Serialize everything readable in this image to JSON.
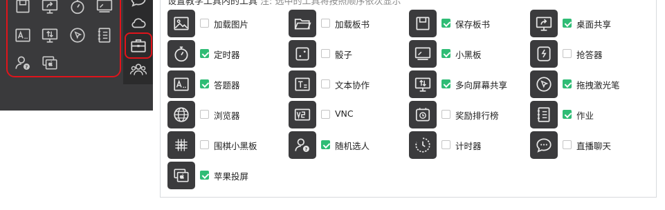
{
  "settings": {
    "title": "设置教学工具内的工具",
    "note": "注: 选中的工具将按照顺序依次显示"
  },
  "tools": [
    {
      "label": "加载图片",
      "checked": false,
      "icon": "image-icon"
    },
    {
      "label": "加载板书",
      "checked": false,
      "icon": "folder-icon"
    },
    {
      "label": "保存板书",
      "checked": true,
      "icon": "save-icon"
    },
    {
      "label": "桌面共享",
      "checked": true,
      "icon": "screen-share-icon"
    },
    {
      "label": "定时器",
      "checked": true,
      "icon": "stopwatch-icon"
    },
    {
      "label": "骰子",
      "checked": false,
      "icon": "dice-icon"
    },
    {
      "label": "小黑板",
      "checked": true,
      "icon": "blackboard-icon"
    },
    {
      "label": "抢答器",
      "checked": false,
      "icon": "buzzer-icon"
    },
    {
      "label": "答题器",
      "checked": true,
      "icon": "answer-icon"
    },
    {
      "label": "文本协作",
      "checked": false,
      "icon": "text-collab-icon"
    },
    {
      "label": "多向屏幕共享",
      "checked": true,
      "icon": "multi-screen-icon"
    },
    {
      "label": "拖拽激光笔",
      "checked": true,
      "icon": "laser-pointer-icon"
    },
    {
      "label": "浏览器",
      "checked": false,
      "icon": "globe-icon"
    },
    {
      "label": "VNC",
      "checked": false,
      "icon": "vnc-icon"
    },
    {
      "label": "奖励排行榜",
      "checked": false,
      "icon": "reward-icon"
    },
    {
      "label": "作业",
      "checked": true,
      "icon": "homework-icon"
    },
    {
      "label": "围棋小黑板",
      "checked": false,
      "icon": "go-board-icon"
    },
    {
      "label": "随机选人",
      "checked": true,
      "icon": "random-person-icon"
    },
    {
      "label": "计时器",
      "checked": false,
      "icon": "timer-icon"
    },
    {
      "label": "直播聊天",
      "checked": false,
      "icon": "chat-icon"
    },
    {
      "label": "苹果投屏",
      "checked": true,
      "icon": "apple-cast-icon"
    }
  ],
  "preview": {
    "toolbox_icons": [
      "save-icon",
      "screen-share-icon",
      "stopwatch-icon",
      "blackboard-icon",
      "answer-icon",
      "multi-screen-icon",
      "laser-pointer-icon",
      "homework-icon",
      "random-person-icon",
      "apple-cast-icon"
    ],
    "side_icons": [
      "chat-icon",
      "cloud-icon",
      "toolbox-icon",
      "people-icon"
    ]
  },
  "colors": {
    "accent_check": "#2fbc75",
    "highlight": "#e0141b",
    "tile_bg": "#3b3b3d"
  }
}
